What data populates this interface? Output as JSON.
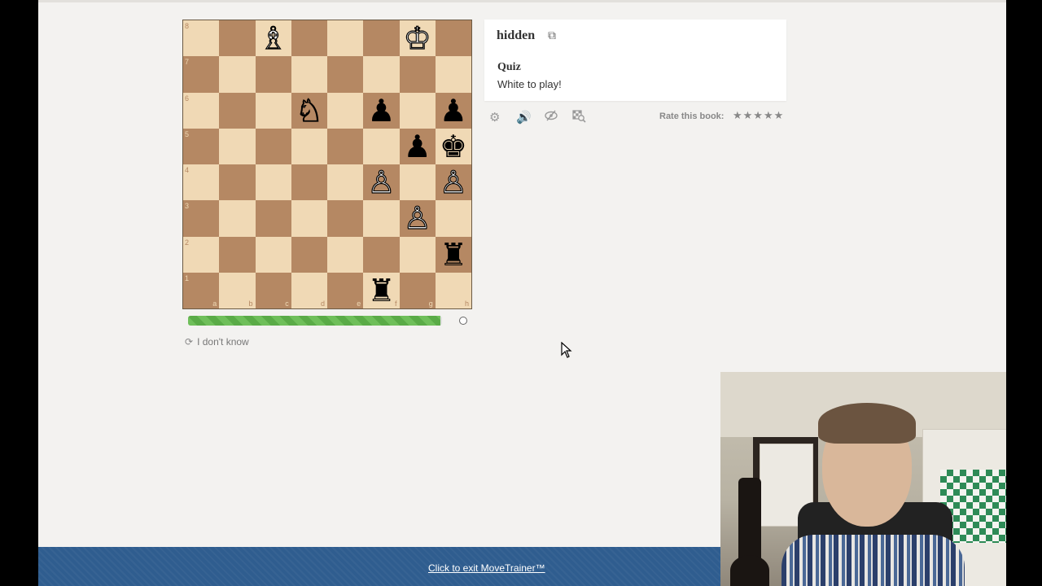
{
  "board": {
    "files": [
      "a",
      "b",
      "c",
      "d",
      "e",
      "f",
      "g",
      "h"
    ],
    "ranks": [
      "8",
      "7",
      "6",
      "5",
      "4",
      "3",
      "2",
      "1"
    ],
    "squares": [
      [
        "",
        "",
        "wB",
        "",
        "",
        "",
        "wK",
        ""
      ],
      [
        "",
        "",
        "",
        "",
        "",
        "",
        "",
        ""
      ],
      [
        "",
        "",
        "",
        "wN",
        "",
        "bP",
        "",
        "bP"
      ],
      [
        "",
        "",
        "",
        "",
        "",
        "",
        "bP",
        "bK"
      ],
      [
        "",
        "",
        "",
        "",
        "",
        "wP",
        "",
        "wP"
      ],
      [
        "",
        "",
        "",
        "",
        "",
        "",
        "wP",
        ""
      ],
      [
        "",
        "",
        "",
        "",
        "",
        "",
        "",
        "bR"
      ],
      [
        "",
        "",
        "",
        "",
        "",
        "bR",
        "",
        ""
      ]
    ],
    "piece_glyphs": {
      "wK": "♔",
      "wB": "♗",
      "wN": "♘",
      "wP": "♙",
      "bK": "♚",
      "bR": "♜",
      "bP": "♟"
    }
  },
  "progress": {
    "fill_fraction": 0.995
  },
  "actions": {
    "dont_know_label": "I don't know",
    "dont_know_icon": "refresh-icon"
  },
  "panel": {
    "title": "hidden",
    "title_icon": "external-link-icon",
    "quiz_label": "Quiz",
    "quiz_text": "White to play!"
  },
  "toolbar": {
    "icons": [
      "gear-icon",
      "speaker-icon",
      "eye-slash-icon",
      "board-search-icon"
    ],
    "rate_label": "Rate this book:",
    "stars": "★★★★★"
  },
  "footer": {
    "exit_link": "Click to exit MoveTrainer™"
  },
  "colors": {
    "light_square": "#f0d9b5",
    "dark_square": "#b58863",
    "footer": "#2f5d8f",
    "progress": "#6fbf5a"
  }
}
